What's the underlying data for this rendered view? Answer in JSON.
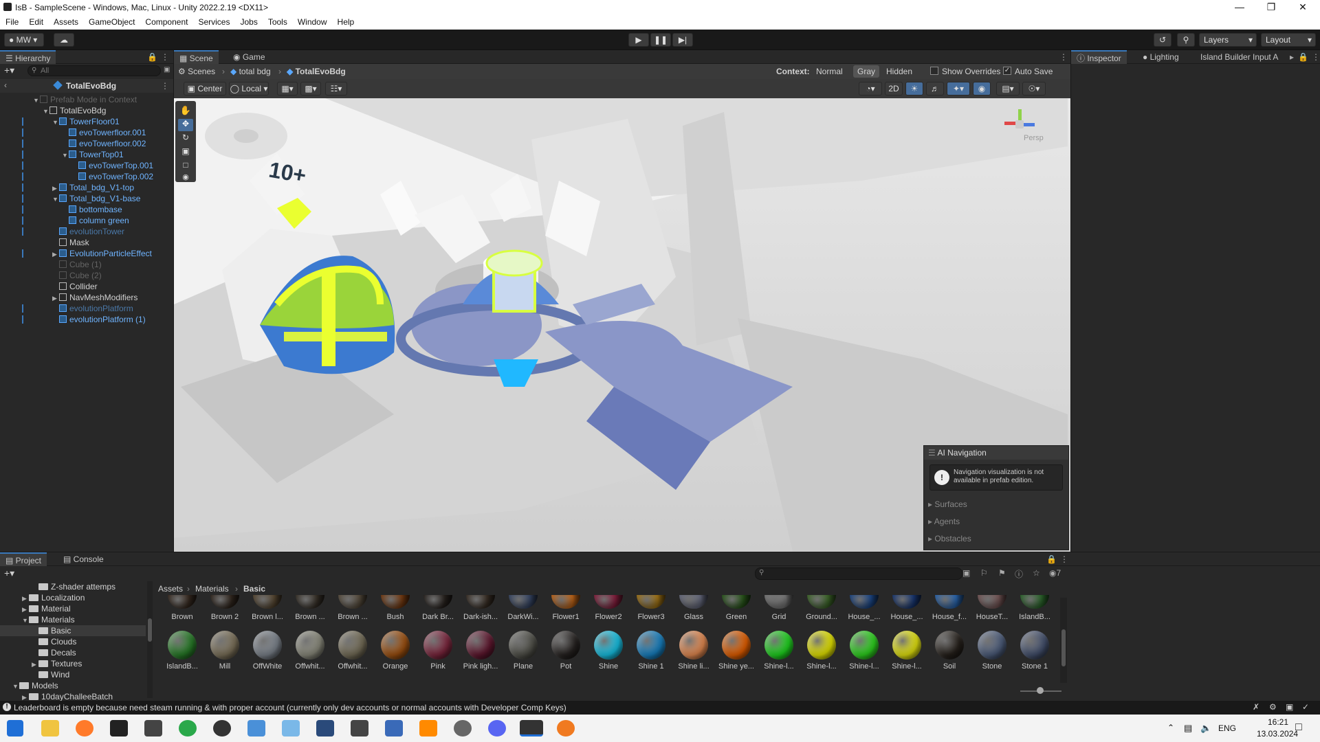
{
  "window": {
    "title": "IsB - SampleScene - Windows, Mac, Linux - Unity 2022.2.19 <DX11>"
  },
  "menu": [
    "File",
    "Edit",
    "Assets",
    "GameObject",
    "Component",
    "Services",
    "Jobs",
    "Tools",
    "Window",
    "Help"
  ],
  "toolbar": {
    "account": "MW",
    "layers": "Layers",
    "layout": "Layout"
  },
  "hierarchy": {
    "tab": "Hierarchy",
    "search_placeholder": "All",
    "root": "TotalEvoBdg",
    "rows": [
      {
        "label": "Prefab Mode in Context",
        "indent": 0,
        "style": "faded",
        "arrow": "▼"
      },
      {
        "label": "TotalEvoBdg",
        "indent": 1,
        "style": "normal",
        "arrow": "▼"
      },
      {
        "label": "TowerFloor01",
        "indent": 2,
        "style": "blue",
        "arrow": "▼"
      },
      {
        "label": "evoTowerfloor.001",
        "indent": 3,
        "style": "blue",
        "arrow": ""
      },
      {
        "label": "evoTowerfloor.002",
        "indent": 3,
        "style": "blue",
        "arrow": ""
      },
      {
        "label": "TowerTop01",
        "indent": 3,
        "style": "blue",
        "arrow": "▼"
      },
      {
        "label": "evoTowerTop.001",
        "indent": 4,
        "style": "blue",
        "arrow": ""
      },
      {
        "label": "evoTowerTop.002",
        "indent": 4,
        "style": "blue",
        "arrow": ""
      },
      {
        "label": "Total_bdg_V1-top",
        "indent": 2,
        "style": "blue",
        "arrow": "▶"
      },
      {
        "label": "Total_bdg_V1-base",
        "indent": 2,
        "style": "blue",
        "arrow": "▼"
      },
      {
        "label": "bottombase",
        "indent": 3,
        "style": "blue",
        "arrow": ""
      },
      {
        "label": "column green",
        "indent": 3,
        "style": "blue",
        "arrow": ""
      },
      {
        "label": "evolutionTower",
        "indent": 2,
        "style": "fadedblue",
        "arrow": ""
      },
      {
        "label": "Mask",
        "indent": 2,
        "style": "normal",
        "arrow": ""
      },
      {
        "label": "EvolutionParticleEffect",
        "indent": 2,
        "style": "blue",
        "arrow": "▶"
      },
      {
        "label": "Cube (1)",
        "indent": 2,
        "style": "faded",
        "arrow": ""
      },
      {
        "label": "Cube (2)",
        "indent": 2,
        "style": "faded",
        "arrow": ""
      },
      {
        "label": "Collider",
        "indent": 2,
        "style": "normal",
        "arrow": ""
      },
      {
        "label": "NavMeshModifiers",
        "indent": 2,
        "style": "normal",
        "arrow": "▶"
      },
      {
        "label": "evolutionPlatform",
        "indent": 2,
        "style": "fadedblue",
        "arrow": ""
      },
      {
        "label": "evolutionPlatform (1)",
        "indent": 2,
        "style": "blue",
        "arrow": ""
      }
    ]
  },
  "scene": {
    "tab_scene": "Scene",
    "tab_game": "Game",
    "breadcrumb": [
      "Scenes",
      "total bdg",
      "TotalEvoBdg"
    ],
    "context_label": "Context:",
    "context_options": [
      "Normal",
      "Gray",
      "Hidden"
    ],
    "context_selected": "Gray",
    "show_overrides": "Show Overrides",
    "auto_save": "Auto Save",
    "pivot": "Center",
    "space": "Local",
    "mode_2d": "2D",
    "persp": "Persp",
    "scene_text": "10+"
  },
  "ai_nav": {
    "title": "AI Navigation",
    "message": "Navigation visualization is not available in prefab edition.",
    "items": [
      "Surfaces",
      "Agents",
      "Obstacles"
    ]
  },
  "inspector": {
    "tabs": [
      "Inspector",
      "Lighting",
      "Island Builder Input A"
    ]
  },
  "project": {
    "tab_project": "Project",
    "tab_console": "Console",
    "tree": [
      {
        "label": "Z-shader attemps",
        "indent": 2,
        "arrow": ""
      },
      {
        "label": "Localization",
        "indent": 1,
        "arrow": "▶"
      },
      {
        "label": "Material",
        "indent": 1,
        "arrow": "▶"
      },
      {
        "label": "Materials",
        "indent": 1,
        "arrow": "▼"
      },
      {
        "label": "Basic",
        "indent": 2,
        "arrow": "",
        "selected": true
      },
      {
        "label": "Clouds",
        "indent": 2,
        "arrow": ""
      },
      {
        "label": "Decals",
        "indent": 2,
        "arrow": ""
      },
      {
        "label": "Textures",
        "indent": 2,
        "arrow": "▶"
      },
      {
        "label": "Wind",
        "indent": 2,
        "arrow": ""
      },
      {
        "label": "Models",
        "indent": 0,
        "arrow": "▼"
      },
      {
        "label": "10dayChalleeBatch",
        "indent": 1,
        "arrow": "▶"
      }
    ],
    "path": [
      "Assets",
      "Materials",
      "Basic"
    ],
    "hidden_count": "7",
    "row1": [
      {
        "name": "Brown",
        "color": "#3a2c22"
      },
      {
        "name": "Brown 2",
        "color": "#33281f"
      },
      {
        "name": "Brown l...",
        "color": "#5a4a34"
      },
      {
        "name": "Brown ...",
        "color": "#3a332a"
      },
      {
        "name": "Brown ...",
        "color": "#5b5040"
      },
      {
        "name": "Bush",
        "color": "#7a3d12"
      },
      {
        "name": "Dark Br...",
        "color": "#2a2420"
      },
      {
        "name": "Dark-ish...",
        "color": "#3b3026"
      },
      {
        "name": "DarkWi...",
        "color": "#3a4a6a"
      },
      {
        "name": "Flower1",
        "color": "#c86a1a"
      },
      {
        "name": "Flower2",
        "color": "#8a2040"
      },
      {
        "name": "Flower3",
        "color": "#a77816"
      },
      {
        "name": "Glass",
        "color": "#6a6e82"
      },
      {
        "name": "Green",
        "color": "#2b5a1c"
      },
      {
        "name": "Grid",
        "color": "#7d7d7d"
      },
      {
        "name": "Ground...",
        "color": "#3f6a2a"
      },
      {
        "name": "House_...",
        "color": "#1d4a8c"
      },
      {
        "name": "House_...",
        "color": "#1a3a78"
      },
      {
        "name": "House_f...",
        "color": "#2b6ab6"
      },
      {
        "name": "HouseT...",
        "color": "#7a5a5a"
      },
      {
        "name": "IslandB...",
        "color": "#2e6a2e"
      }
    ],
    "row2": [
      {
        "name": "IslandB...",
        "color": "#2c8a2c"
      },
      {
        "name": "Mill",
        "color": "#8a7e64"
      },
      {
        "name": "OffWhite",
        "color": "#8a929c"
      },
      {
        "name": "Offwhit...",
        "color": "#9a9a8a"
      },
      {
        "name": "Offwhit...",
        "color": "#827a62"
      },
      {
        "name": "Orange",
        "color": "#b05a12"
      },
      {
        "name": "Pink",
        "color": "#8a2a44"
      },
      {
        "name": "Pink ligh...",
        "color": "#6a1a34"
      },
      {
        "name": "Plane",
        "color": "#5a5a52"
      },
      {
        "name": "Pot",
        "color": "#2a2624"
      },
      {
        "name": "Shine",
        "color": "#18d8ff"
      },
      {
        "name": "Shine 1",
        "color": "#1a90d8"
      },
      {
        "name": "Shine li...",
        "color": "#ff9a5a"
      },
      {
        "name": "Shine ye...",
        "color": "#ff6a00"
      },
      {
        "name": "Shine-l...",
        "color": "#22ee22"
      },
      {
        "name": "Shine-l...",
        "color": "#ffff00"
      },
      {
        "name": "Shine-l...",
        "color": "#33ee22"
      },
      {
        "name": "Shine-l...",
        "color": "#ffff10"
      },
      {
        "name": "Soil",
        "color": "#2a241e"
      },
      {
        "name": "Stone",
        "color": "#56688a"
      },
      {
        "name": "Stone 1",
        "color": "#4c5a7a"
      }
    ]
  },
  "status": {
    "message": "Leaderboard is empty because need steam running & with proper account (currently only dev accounts or normal accounts with Developer Comp Keys)"
  },
  "taskbar": {
    "lang": "ENG",
    "time": "16:21",
    "date": "13.03.2024"
  }
}
